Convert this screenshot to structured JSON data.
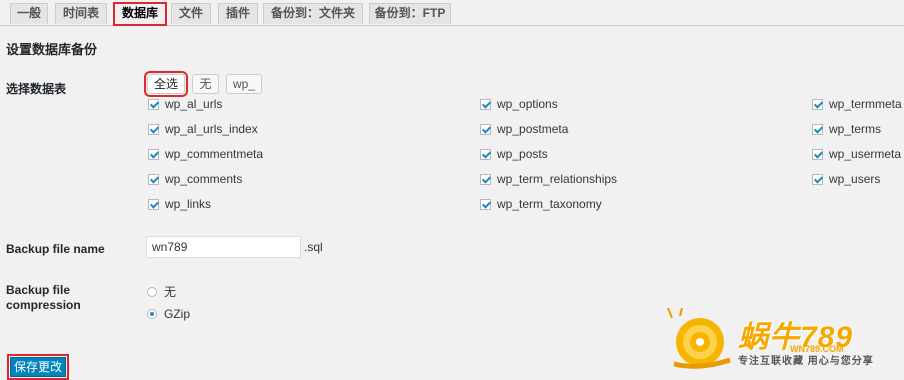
{
  "tabs": [
    {
      "label": "一般"
    },
    {
      "label": "时间表"
    },
    {
      "label": "数据库"
    },
    {
      "label": "文件"
    },
    {
      "label": "插件"
    },
    {
      "label": "备份到：文件夹"
    },
    {
      "label": "备份到：FTP"
    }
  ],
  "section_title": "设置数据库备份",
  "select_tables": {
    "label": "选择数据表",
    "buttons": {
      "all": "全选",
      "none": "无",
      "wp": "wp_"
    },
    "col1": [
      "wp_al_urls",
      "wp_al_urls_index",
      "wp_commentmeta",
      "wp_comments",
      "wp_links"
    ],
    "col2": [
      "wp_options",
      "wp_postmeta",
      "wp_posts",
      "wp_term_relationships",
      "wp_term_taxonomy"
    ],
    "col3": [
      "wp_termmeta",
      "wp_terms",
      "wp_usermeta",
      "wp_users"
    ]
  },
  "backup_file": {
    "label": "Backup file name",
    "value": "wn789",
    "suffix": ".sql"
  },
  "compression": {
    "label_line1": "Backup file",
    "label_line2": "compression",
    "options": [
      "无",
      "GZip"
    ],
    "selected": "GZip"
  },
  "save_button": "保存更改",
  "watermark": {
    "brand": "蜗牛789",
    "url": "WN789.COM",
    "slogan": "专注互联收藏  用心与您分享"
  },
  "colors": {
    "accent": "#0085ba",
    "highlight": "#e0262e",
    "logo": "#f5a800"
  }
}
